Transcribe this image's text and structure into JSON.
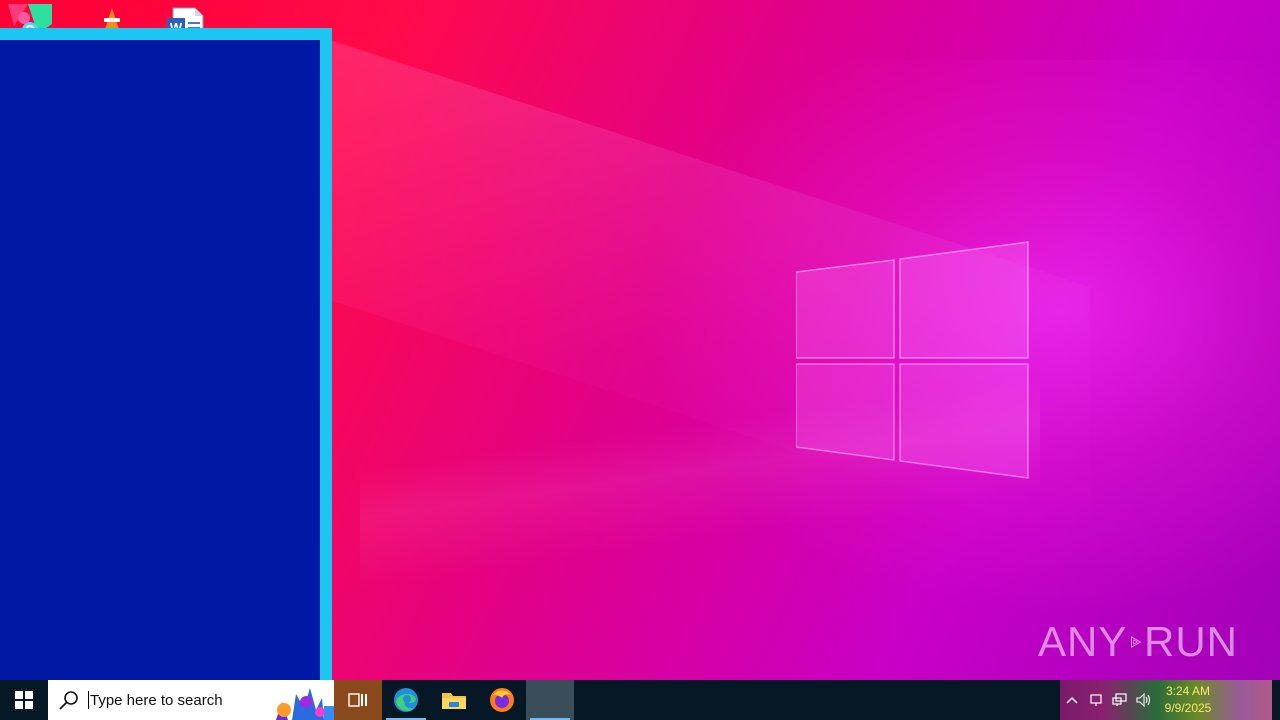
{
  "desktop": {
    "icons": [
      {
        "name": "Recycle Bin",
        "icon": "recycle-bin-icon"
      },
      {
        "name": "VLC media player",
        "icon": "vlc-icon"
      },
      {
        "name": "Word document",
        "icon": "word-document-icon"
      }
    ]
  },
  "watermark": {
    "left": "ANY",
    "right": "RUN"
  },
  "taskbar": {
    "search": {
      "placeholder": "Type here to search"
    },
    "pinned": [
      {
        "name": "Task View",
        "icon": "task-view-icon"
      },
      {
        "name": "Microsoft Edge",
        "icon": "edge-icon"
      },
      {
        "name": "File Explorer",
        "icon": "folder-icon"
      },
      {
        "name": "Firefox",
        "icon": "firefox-icon"
      }
    ],
    "clock": {
      "time": "3:24 AM",
      "date": "9/9/2025"
    }
  },
  "colors": {
    "window_body": "#0019a4",
    "window_frame": "#1cc6f0",
    "taskbar": "#061826",
    "clock_text": "#f8e870"
  }
}
